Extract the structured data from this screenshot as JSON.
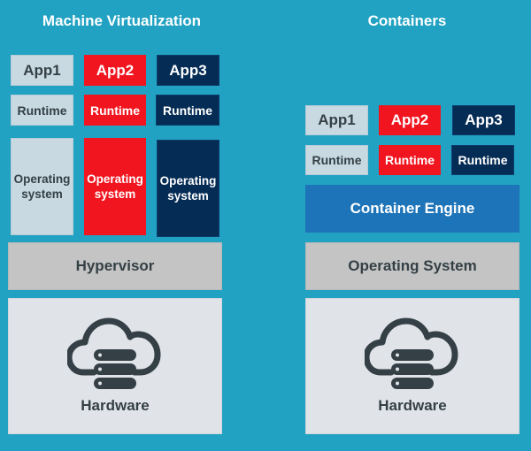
{
  "colors": {
    "background": "#21a2c2",
    "app1": "#c8d9e2",
    "app2": "#f1151f",
    "app3": "#052c55",
    "hypervisor": "#c4c4c4",
    "container_engine": "#1d74b8",
    "hardware": "#e0e3e8",
    "dark_text": "#344045"
  },
  "machine_virtualization": {
    "title": "Machine Virtualization",
    "apps": [
      "App1",
      "App2",
      "App3"
    ],
    "runtimes": [
      "Runtime",
      "Runtime",
      "Runtime"
    ],
    "operating_systems": [
      "Operating system",
      "Operating system",
      "Operating system"
    ],
    "hypervisor": "Hypervisor",
    "hardware": {
      "label": "Hardware",
      "icon": "cloud-server-icon"
    }
  },
  "containers": {
    "title": "Containers",
    "apps": [
      "App1",
      "App2",
      "App3"
    ],
    "runtimes": [
      "Runtime",
      "Runtime",
      "Runtime"
    ],
    "container_engine": "Container Engine",
    "operating_system": "Operating System",
    "hardware": {
      "label": "Hardware",
      "icon": "cloud-server-icon"
    }
  }
}
